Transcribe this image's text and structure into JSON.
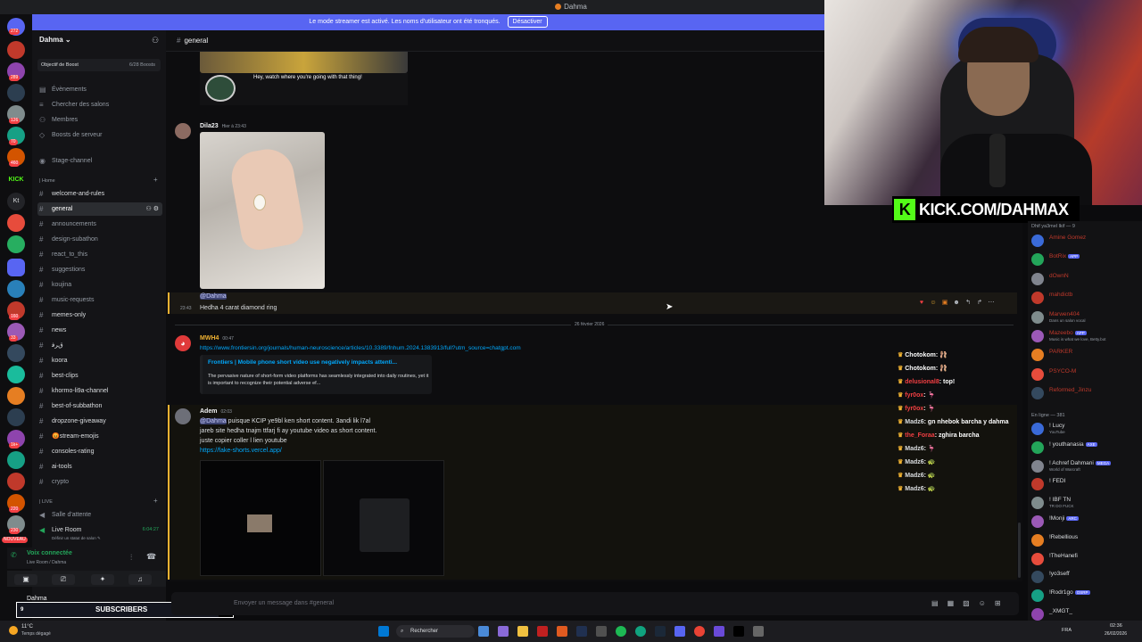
{
  "window": {
    "title": "Dahma"
  },
  "banner": {
    "text": "Le mode streamer est activé. Les noms d'utilisateur ont été tronqués.",
    "button": "Désactiver"
  },
  "guild_badges": [
    "272",
    "289",
    "5",
    "126",
    "70",
    "460",
    "1",
    "12",
    "160",
    "33",
    "214",
    "1k+",
    "220",
    "230",
    "NOUVEAU"
  ],
  "guild_labels": {
    "kick": "KICK",
    "kt": "Kt"
  },
  "server": {
    "name": "Dahma",
    "boost_label": "Objectif de Boost",
    "boost_count": "6/28 Boosts"
  },
  "sidebar_items": [
    "Évènements",
    "Chercher des salons",
    "Membres",
    "Boosts de serveur"
  ],
  "stage_channel": "Stage-channel",
  "categories": {
    "home": "| Home",
    "live": "| LIVE"
  },
  "channels": [
    "welcome-and-rules",
    "general",
    "announcements",
    "design-subathon",
    "react_to_this",
    "suggestions",
    "koujina",
    "music-requests",
    "memes-only",
    "news",
    "ﻕﺮﻓ",
    "koora",
    "best-clips",
    "khormo-li9a-channel",
    "best-of-subbathon",
    "dropzone-giveaway",
    "😡stream-emojis",
    "consoles-rating",
    "ai-tools",
    "crypto"
  ],
  "voice_channels": {
    "waiting": "Salle d'attente",
    "live_room": "Live Room",
    "live_room_status": "Définir un statut de salon ✎",
    "live_time": "6:04:27"
  },
  "voice_status": {
    "title": "Voix connectée",
    "sub": "Live Room / Dahma"
  },
  "subscribers": {
    "label": "SUBSCRIBERS",
    "count": "10",
    "left": "9"
  },
  "user": {
    "name": "Dahma"
  },
  "chat_header": {
    "channel": "general"
  },
  "messages": {
    "sticker_caption": "Hey, watch where you're going with that thing!",
    "dila_author": "Dila23",
    "dila_time": "Hier à 23:43",
    "reply_mention": "@Dahma",
    "reply_time": "23:43",
    "reply_text": "Hedha 4 carat diamond ring",
    "date_divider": "26 février 2026",
    "mwh_author": "MWH4",
    "mwh_time": "00:47",
    "mwh_link": "https://www.frontiersin.org/journals/human-neuroscience/articles/10.3389/fnhum.2024.1383913/full?utm_source=chatgpt.com",
    "embed_title": "Frontiers | Mobile phone short video use negatively impacts attenti...",
    "embed_desc": "The pervasive nature of short-form video platforms has seamlessly integrated into daily routines, yet it is important to recognize their potential adverse ef...",
    "adem_author": "Adem",
    "adem_time": "02:03",
    "adem_mention": "@Dahma",
    "adem_line1": "puisque KCIP ye9bl ken short content. 3andi lik l7al",
    "adem_line2": "jareb site hedha tnajm ttfarj fi ay youtube video as short content.",
    "adem_line3": "juste copier coller l lien youtube",
    "adem_link": "https://fake-shorts.vercel.app/"
  },
  "input": {
    "placeholder": "Envoyer un message dans #general"
  },
  "webcam": {
    "kick_url": "KICK.COM/DAHMAX",
    "kick_logo": "K"
  },
  "stream_chat": [
    {
      "user": "Chotokom",
      "text": ": 🩰"
    },
    {
      "user": "Chotokom",
      "text": ": 🩰"
    },
    {
      "user": "delusional8",
      "text": ": top!"
    },
    {
      "user": "fyr0ox",
      "text": ": 🦩"
    },
    {
      "user": "fyr0ox",
      "text": ": 🦩"
    },
    {
      "user": "Madz6",
      "text": ": gn nhebok barcha y dahma"
    },
    {
      "user": "the_Foraa",
      "text": ": zghira barcha"
    },
    {
      "user": "Madz6",
      "text": ": 🦩"
    },
    {
      "user": "Madz6",
      "text": ": 🐢"
    },
    {
      "user": "Madz6",
      "text": ": 🐢"
    },
    {
      "user": "Madz6",
      "text": ": 🐢"
    }
  ],
  "members": {
    "header_top": "Dhif ya3mel lkif — 9",
    "header_online": "En ligne — 381",
    "top": [
      {
        "name": "Amine Gomez",
        "sub": "",
        "tag": ""
      },
      {
        "name": "BotRix",
        "sub": "",
        "tag": "APP"
      },
      {
        "name": "dOwnN",
        "sub": "",
        "tag": ""
      },
      {
        "name": "mahdictb",
        "sub": "",
        "tag": ""
      },
      {
        "name": "Marwen404",
        "sub": "Dans un salon vocal",
        "tag": ""
      },
      {
        "name": "Mazeebo",
        "sub": "Music is what we love, Betty.bot",
        "tag": "APP"
      },
      {
        "name": "PARKER",
        "sub": "",
        "tag": ""
      },
      {
        "name": "PSYCO-M",
        "sub": "",
        "tag": ""
      },
      {
        "name": "Reformed_Jinzu",
        "sub": "",
        "tag": ""
      }
    ],
    "online": [
      {
        "name": "! Lucy",
        "sub": "YouTube",
        "tag": ""
      },
      {
        "name": "! youthanasia",
        "sub": "",
        "tag": "AXE"
      },
      {
        "name": "! Achref Dahmani",
        "sub": "World of Warcraft",
        "tag": "MEGA"
      },
      {
        "name": "! FEDI",
        "sub": "",
        "tag": ""
      },
      {
        "name": "! IBF TN",
        "sub": "TR DO FUCK",
        "tag": ""
      },
      {
        "name": "!Monji",
        "sub": "",
        "tag": "ARC"
      },
      {
        "name": "!Rebellious",
        "sub": "",
        "tag": ""
      },
      {
        "name": "!TheHanefi",
        "sub": "",
        "tag": ""
      },
      {
        "name": "!yo3seff",
        "sub": "",
        "tag": ""
      },
      {
        "name": "!Rodr1go",
        "sub": "",
        "tag": "OSRP"
      },
      {
        "name": "_XMGT_",
        "sub": "",
        "tag": ""
      }
    ]
  },
  "taskbar": {
    "weather_temp": "11°C",
    "weather_desc": "Temps dégagé",
    "search": "Rechercher",
    "lang": "FRA",
    "time": "02:36",
    "date": "26/02/2026"
  },
  "colors": {
    "accent": "#5865f2",
    "kick_green": "#53fc18",
    "link": "#00a8fc",
    "reply_bar": "#f0b232"
  }
}
